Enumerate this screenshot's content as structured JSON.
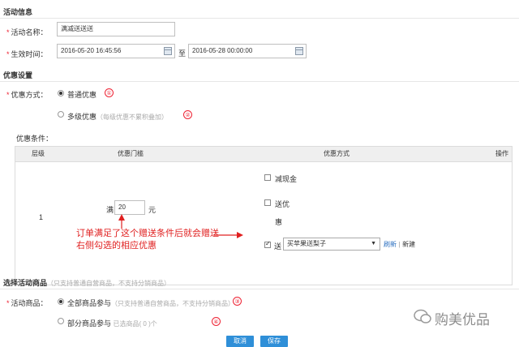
{
  "activity_info": {
    "section_title": "活动信息",
    "name_label": "活动名称：",
    "name_value": "满减送送送",
    "time_label": "生效时间：",
    "start_time": "2016-05-20 16:45:56",
    "to_label": "至",
    "end_time": "2016-05-28 00:00:00"
  },
  "discount_settings": {
    "section_title": "优惠设置",
    "method_label": "优惠方式：",
    "option_normal": "普通优惠",
    "option_multi": "多级优惠",
    "option_multi_hint": "（每级优惠不累积叠加）",
    "circle_1": "①",
    "circle_2": "②",
    "condition_label": "优惠条件："
  },
  "table": {
    "headers": [
      "层级",
      "优惠门槛",
      "优惠方式",
      "操作"
    ],
    "row": {
      "level": "1",
      "threshold_prefix": "满",
      "threshold_value": "20",
      "threshold_unit": "元",
      "option_cash": "减现金",
      "option_gift_line1": "送优",
      "option_gift_line2": "惠",
      "option_send": "送",
      "send_select_value": "买苹果送梨子",
      "refresh_link": "刷新",
      "separator": "|",
      "new_link": "新建"
    }
  },
  "annotation": {
    "line1": "订单满足了这个赠送条件后就会赠送",
    "line2": "右侧勾选的相应优惠"
  },
  "goods": {
    "section_title": "选择活动商品",
    "section_hint": "（只支持普通自营商品，不支持分销商品）",
    "goods_label": "活动商品：",
    "option_all": "全部商品参与",
    "option_all_hint": "（只支持普通自营商品，不支持分销商品）",
    "circle_3": "③",
    "option_partial": "部分商品参与",
    "option_partial_hint": "已选商品( 0 )个",
    "circle_4": "④"
  },
  "buttons": {
    "cancel": "取消",
    "save": "保存"
  },
  "watermark": {
    "text": "购美优品"
  },
  "colors": {
    "required_star": "#ee2233",
    "annotation_red": "#e02020",
    "button_blue": "#2f8fd8",
    "link_blue": "#2a6fc0"
  }
}
